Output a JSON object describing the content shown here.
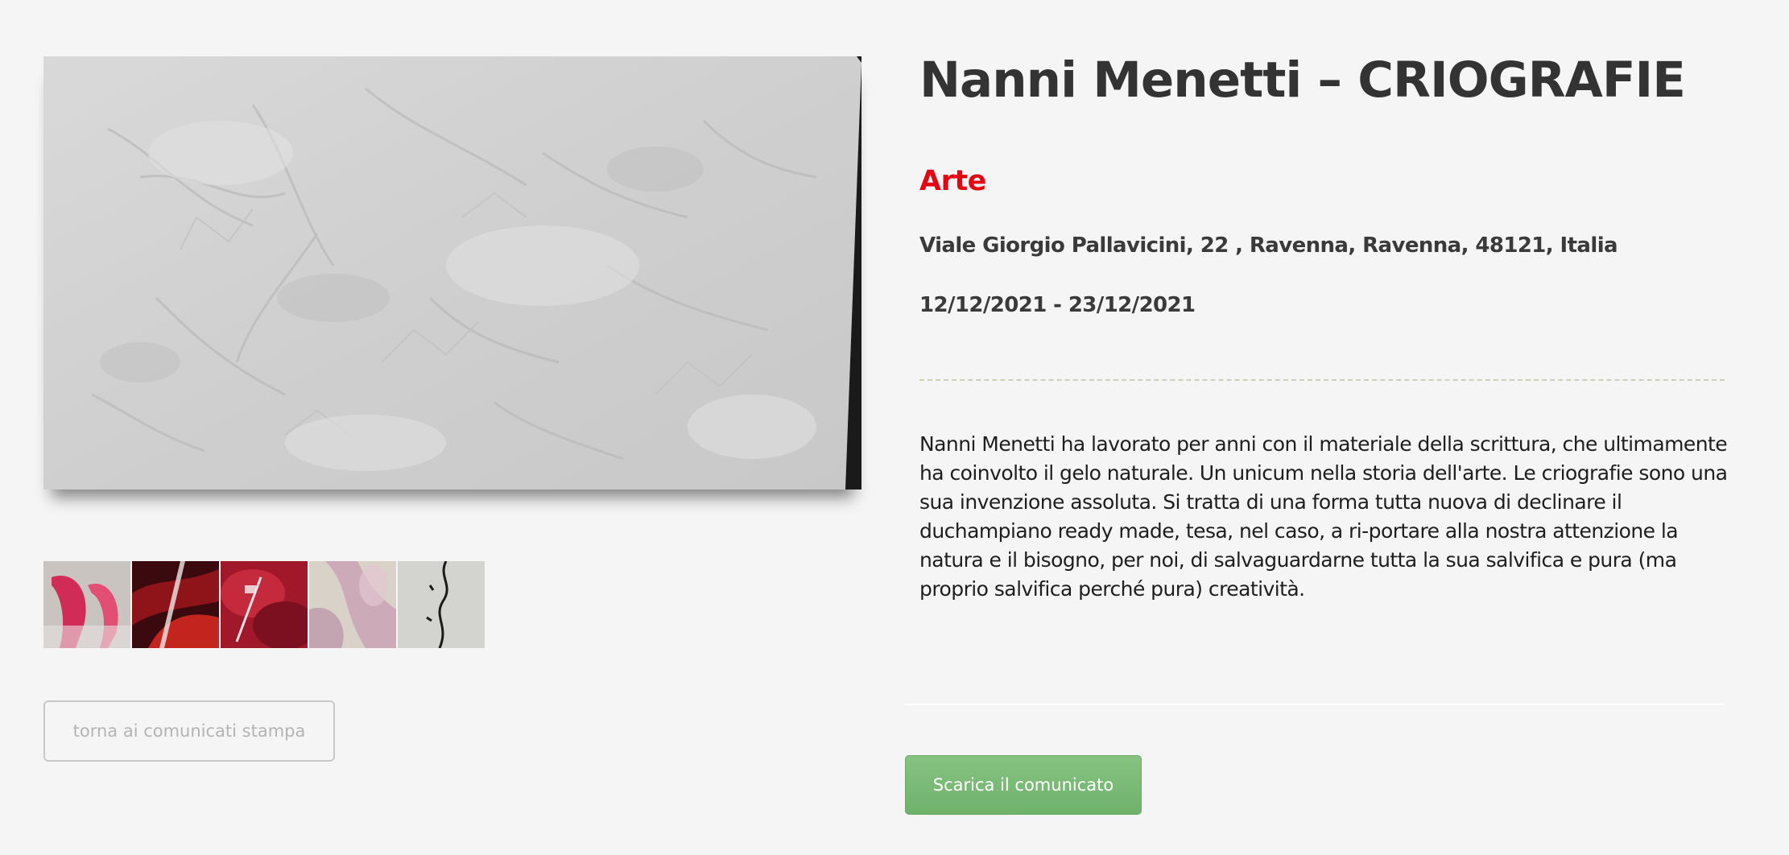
{
  "event": {
    "title": "Nanni Menetti – CRIOGRAFIE",
    "category": "Arte",
    "address": "Viale Giorgio Pallavicini, 22 , Ravenna, Ravenna, 48121, Italia",
    "dates": "12/12/2021 - 23/12/2021",
    "description": "Nanni Menetti ha lavorato per anni con il materiale della scrittura, che ultimamente ha coinvolto il gelo naturale. Un unicum nella storia dell'arte. Le criografie sono una sua invenzione assoluta. Si tratta di una forma tutta nuova di declinare il duchampiano ready made, tesa, nel caso, a ri-portare alla nostra attenzione la natura e il bisogno, per noi, di salvaguardarne tutta la sua salvifica e pura (ma proprio salvifica perché pura) creatività."
  },
  "gallery": {
    "main_image": "frost-artwork-grey",
    "thumbnails": [
      "artwork-thumb-red-curves",
      "artwork-thumb-dark-red",
      "artwork-thumb-red-abstract",
      "artwork-thumb-pink-pastel",
      "artwork-thumb-grey-lines"
    ]
  },
  "actions": {
    "back_label": "torna ai comunicati stampa",
    "download_label": "Scarica il comunicato"
  },
  "colors": {
    "background": "#f5f5f5",
    "title": "#333333",
    "category": "#e30613",
    "download_button": "#76b873",
    "divider": "#c9d3b3"
  }
}
